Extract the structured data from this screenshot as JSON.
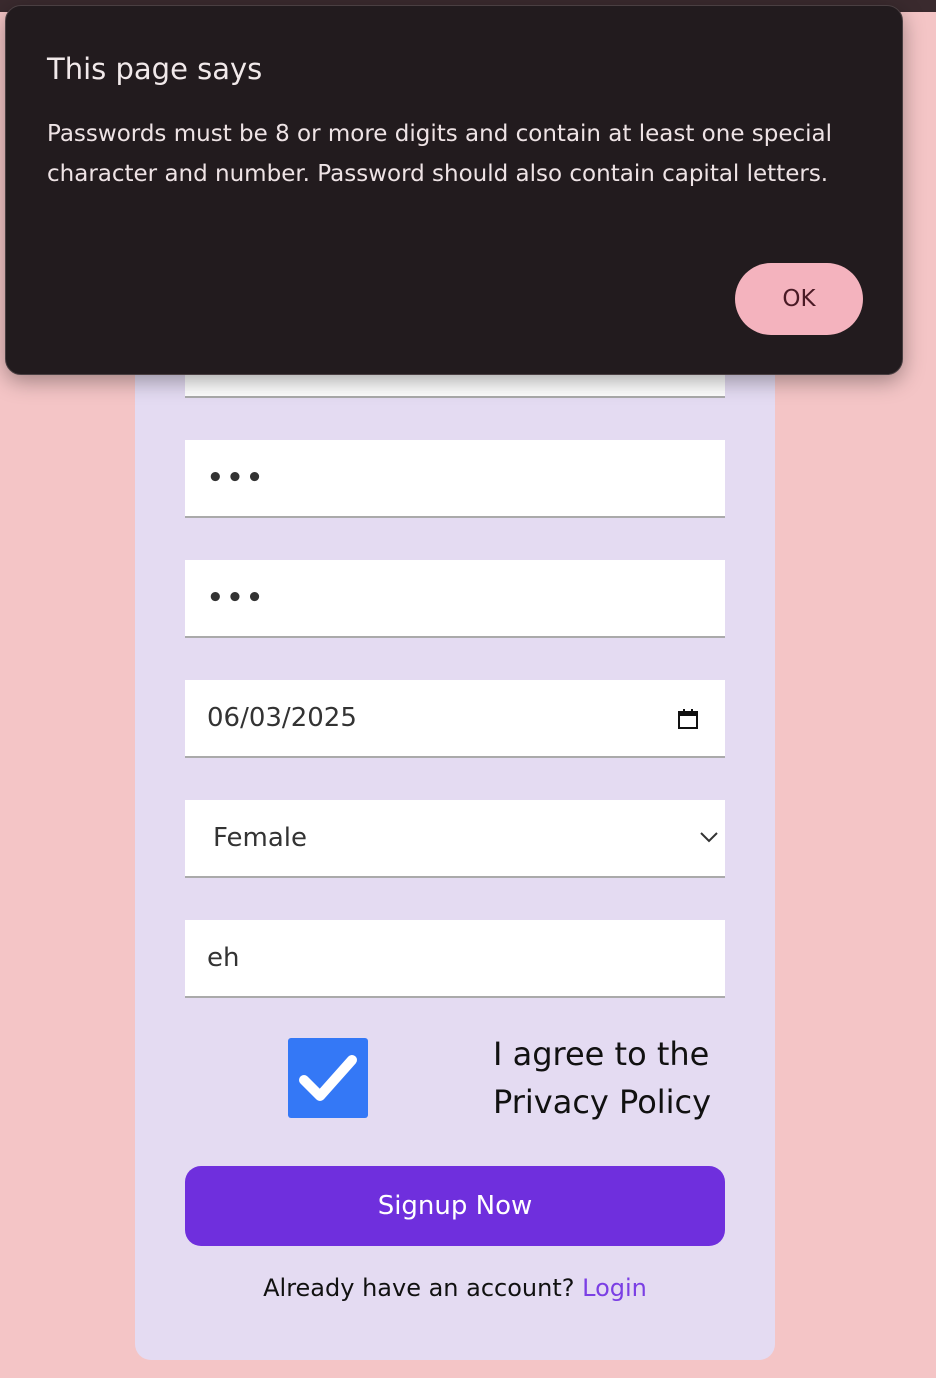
{
  "dialog": {
    "title": "This page says",
    "message": "Passwords must be 8 or more digits and contain at least one special character and number. Password should also contain capital letters.",
    "ok_label": "OK"
  },
  "form": {
    "password_mask": "•••",
    "confirm_password_mask": "•••",
    "date_value": "06/03/2025",
    "gender_value": "Female",
    "text_value": "eh",
    "agree_checked": true,
    "agree_label_line1": "I agree to the",
    "agree_label_line2": "Privacy Policy",
    "signup_label": "Signup Now",
    "already_text": "Already have an account?",
    "login_label": "Login"
  },
  "colors": {
    "page_bg": "#f4c5c6",
    "card_bg": "#e4dbf2",
    "button_bg": "#6f2fdd",
    "checkbox_bg": "#3478f6",
    "dialog_bg": "#221b1e",
    "ok_bg": "#f4b3be",
    "link": "#7b3fe4"
  }
}
